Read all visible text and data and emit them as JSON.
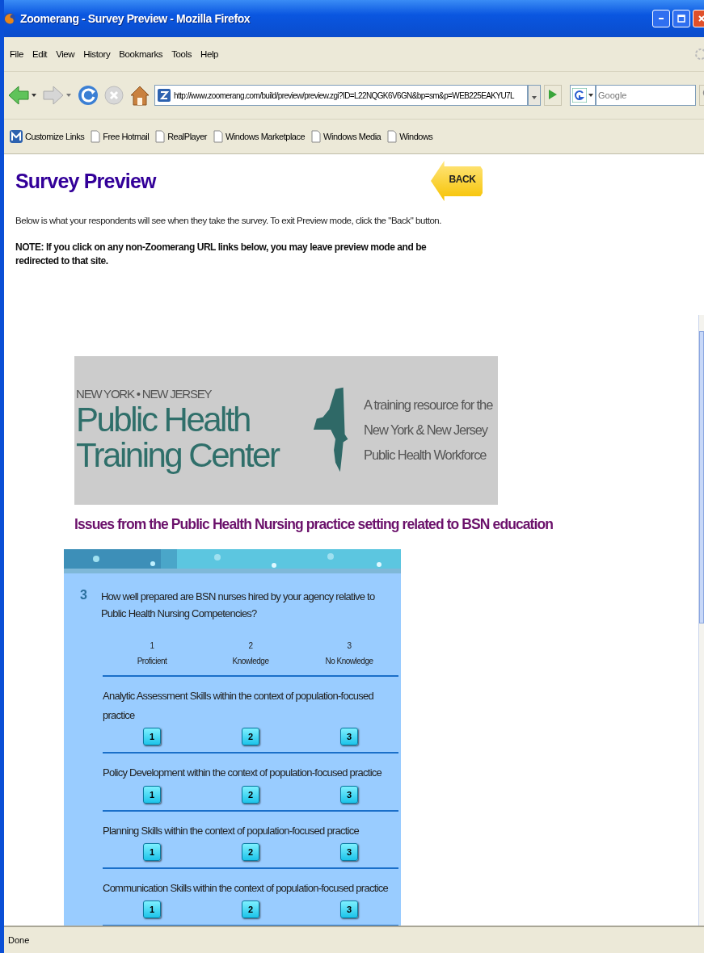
{
  "window": {
    "title": "Zoomerang - Survey Preview - Mozilla Firefox"
  },
  "menu": [
    "File",
    "Edit",
    "View",
    "History",
    "Bookmarks",
    "Tools",
    "Help"
  ],
  "toolbar": {
    "url": "http://www.zoomerang.com/build/preview/preview.zgi?ID=L22NQGK6V6GN&bp=sm&p=WEB225EAKYU7L",
    "search_placeholder": "Google"
  },
  "bookmarks": [
    {
      "label": "Customize Links",
      "kind": "brand"
    },
    {
      "label": "Free Hotmail",
      "kind": "page"
    },
    {
      "label": "RealPlayer",
      "kind": "page"
    },
    {
      "label": "Windows Marketplace",
      "kind": "page"
    },
    {
      "label": "Windows Media",
      "kind": "page"
    },
    {
      "label": "Windows",
      "kind": "page"
    }
  ],
  "page": {
    "title": "Survey Preview",
    "back_button": "BACK",
    "intro": "Below is what your respondents will see when they take the survey. To exit Preview mode, click the \"Back\" button.",
    "note": "NOTE: If you click on any non-Zoomerang URL links below, you may leave preview mode and be redirected to that site."
  },
  "banner": {
    "region": "NEW YORK • NEW JERSEY",
    "name_lines": [
      "Public Health",
      "Training Center"
    ],
    "tagline_lines": [
      "A training resource for the",
      "New York & New Jersey",
      "Public Health Workforce"
    ]
  },
  "survey_heading": "Issues from the Public Health Nursing practice setting related to BSN education",
  "survey": {
    "number": "3",
    "question": "How well prepared are BSN nurses hired by your agency relative to Public Health Nursing Competencies?",
    "scale": [
      {
        "number": "1",
        "label": "Proficient"
      },
      {
        "number": "2",
        "label": "Knowledge"
      },
      {
        "number": "3",
        "label": "No Knowledge"
      }
    ],
    "items": [
      {
        "text": "Analytic Assessment Skills within the context of population-focused practice",
        "options": [
          "1",
          "2",
          "3"
        ]
      },
      {
        "text": "Policy Development within the context of population-focused practice",
        "options": [
          "1",
          "2",
          "3"
        ]
      },
      {
        "text": "Planning Skills within the context of population-focused practice",
        "options": [
          "1",
          "2",
          "3"
        ]
      },
      {
        "text": "Communication Skills within the context of population-focused practice",
        "options": [
          "1",
          "2",
          "3"
        ]
      }
    ]
  },
  "status_bar": "Done"
}
